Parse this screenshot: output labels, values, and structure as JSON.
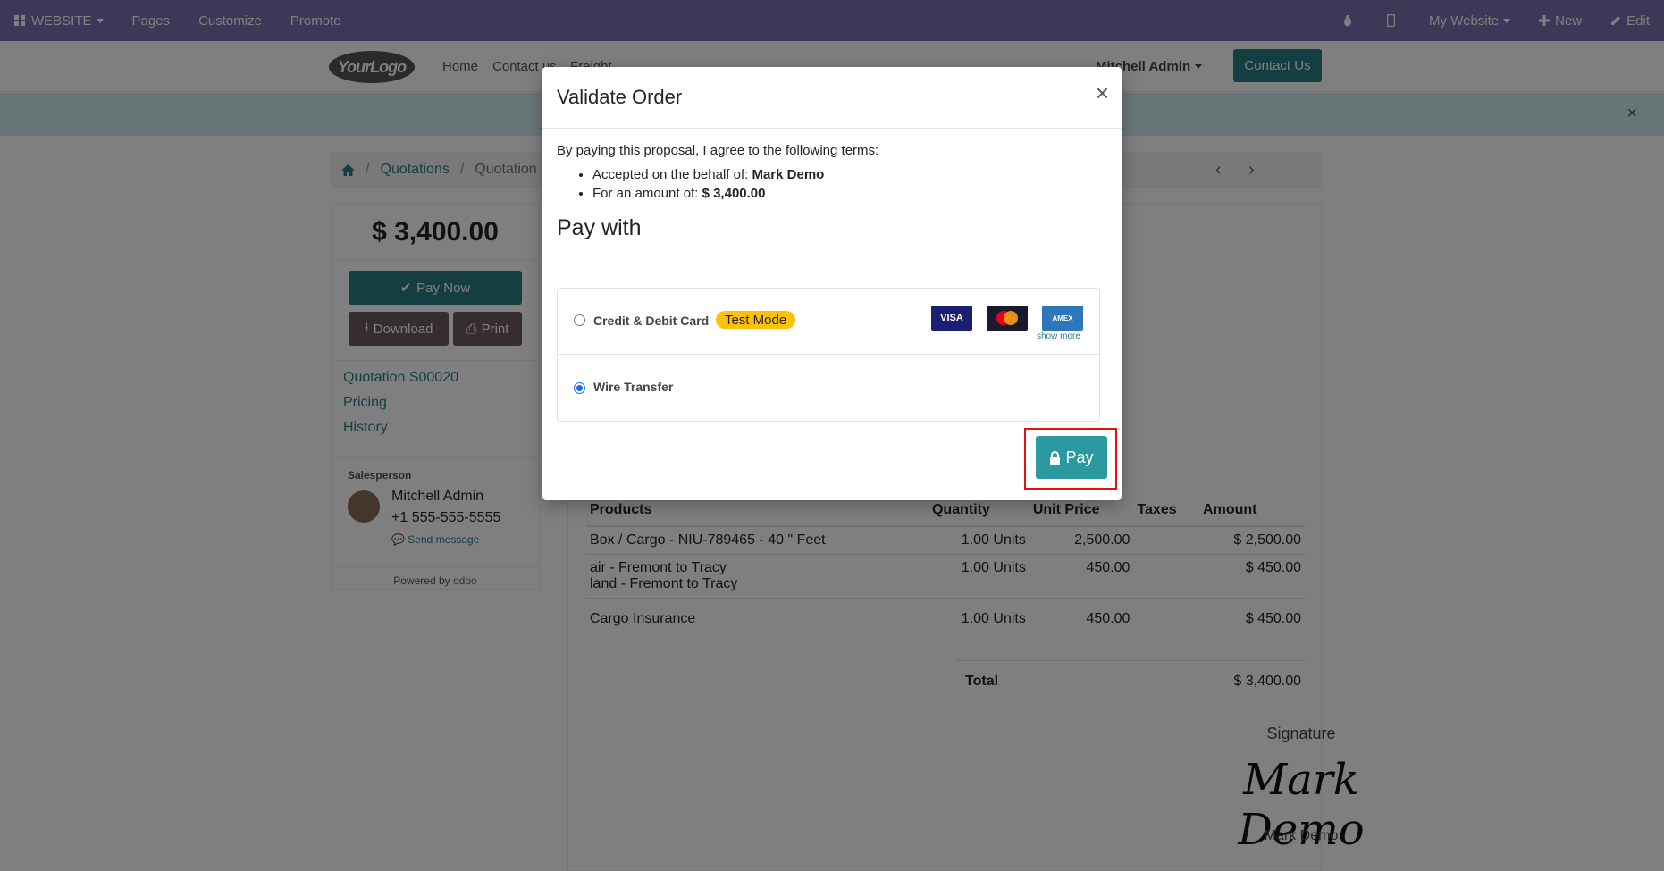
{
  "adminbar": {
    "website": "WEBSITE",
    "pages": "Pages",
    "customize": "Customize",
    "promote": "Promote",
    "my_website": "My Website",
    "new": "New",
    "edit": "Edit"
  },
  "header": {
    "logo_text": "YourLogo",
    "nav": [
      "Home",
      "Contact us",
      "Freight"
    ],
    "user": "Mitchell Admin",
    "contact_button": "Contact Us"
  },
  "breadcrumb": {
    "quotations": "Quotations",
    "current": "Quotation S00020"
  },
  "sidebar": {
    "amount": "$ 3,400.00",
    "pay_now": "Pay Now",
    "download": "Download",
    "print": "Print",
    "links": [
      "Quotation S00020",
      "Pricing",
      "History"
    ],
    "salesperson_title": "Salesperson",
    "salesperson_name": "Mitchell Admin",
    "salesperson_phone": "+1 555-555-5555",
    "send_message": "Send message",
    "powered_by": "Powered by",
    "odoo": "odoo"
  },
  "doc": {
    "headers": [
      "Products",
      "Quantity",
      "Unit Price",
      "Taxes",
      "Amount"
    ],
    "rows": [
      {
        "product": "Box / Cargo - NIU-789465 - 40 \" Feet",
        "product2": "",
        "qty": "1.00 Units",
        "price": "2,500.00",
        "taxes": "",
        "amount": "$ 2,500.00"
      },
      {
        "product": "air - Fremont to Tracy",
        "product2": "land - Fremont to Tracy",
        "qty": "1.00 Units",
        "price": "450.00",
        "taxes": "",
        "amount": "$ 450.00"
      },
      {
        "product": "Cargo Insurance",
        "product2": "",
        "qty": "1.00 Units",
        "price": "450.00",
        "taxes": "",
        "amount": "$ 450.00"
      }
    ],
    "total_label": "Total",
    "total_value": "$ 3,400.00",
    "signature_title": "Signature",
    "signature_script": "Mark Demo",
    "signature_name": "Mark Demo"
  },
  "modal": {
    "title": "Validate Order",
    "intro": "By paying this proposal, I agree to the following terms:",
    "behalf_label": "Accepted on the behalf of:",
    "behalf_value": "Mark Demo",
    "amount_label": "For an amount of:",
    "amount_value": "$ 3,400.00",
    "pay_with": "Pay with",
    "acquirers": [
      {
        "label": "Credit & Debit Card",
        "badge": "Test Mode",
        "selected": false
      },
      {
        "label": "Wire Transfer",
        "selected": true
      }
    ],
    "cards": [
      "VISA",
      "MasterCard",
      "AMEX"
    ],
    "show_more": "show more",
    "pay_button": "Pay",
    "close_glyph": "×"
  },
  "colors": {
    "admin_bar": "#7C6FAE",
    "primary": "#2b7c85",
    "highlight": "#e3120b",
    "badge": "#ffc107"
  }
}
